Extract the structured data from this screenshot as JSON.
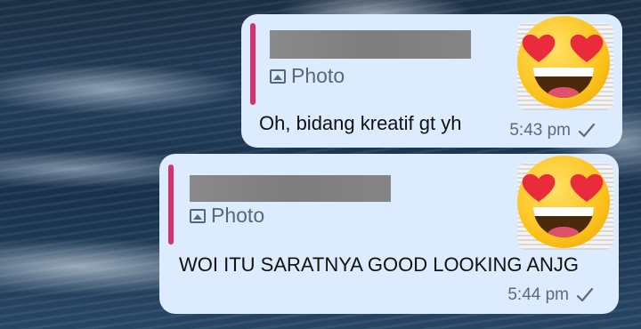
{
  "messages": [
    {
      "reply_preview": {
        "label": "Photo"
      },
      "text": "Oh, bidang kreatif gt yh",
      "time": "5:43 pm"
    },
    {
      "reply_preview": {
        "label": "Photo"
      },
      "text": "WOI ITU SARATNYA GOOD LOOKING ANJG",
      "time": "5:44 pm"
    }
  ],
  "colors": {
    "bubble": "#dcebfd",
    "reply_accent": "#d6336c",
    "meta_text": "#5e6a78"
  },
  "icons": {
    "reply_media": "photo-icon",
    "status": "checkmark-icon",
    "thumbnail": "heart-eyes-emoji-icon"
  }
}
